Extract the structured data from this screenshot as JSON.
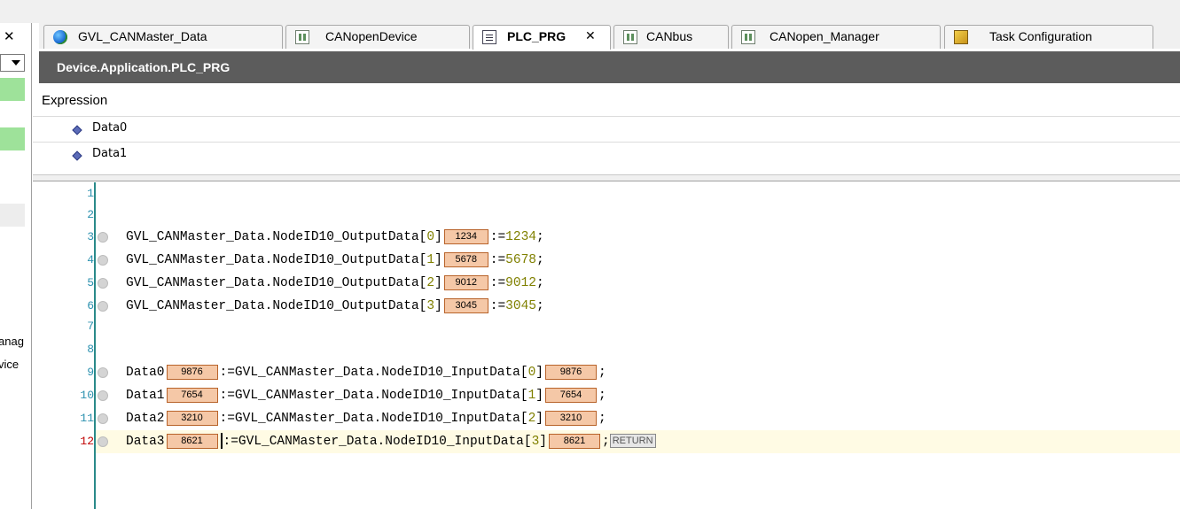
{
  "left_dock": {
    "close_glyph": "✕",
    "items": [
      "anag",
      "vice"
    ]
  },
  "tabs": [
    {
      "label": "GVL_CANMaster_Data",
      "icon": "globe-icon"
    },
    {
      "label": "CANopenDevice",
      "icon": "device-icon"
    },
    {
      "label": "PLC_PRG",
      "icon": "program-icon",
      "active": true,
      "close": "✕"
    },
    {
      "label": "CANbus",
      "icon": "device-icon"
    },
    {
      "label": "CANopen_Manager",
      "icon": "device-icon"
    },
    {
      "label": "Task Configuration",
      "icon": "task-config-icon"
    }
  ],
  "editor": {
    "title": "Device.Application.PLC_PRG"
  },
  "watch": {
    "header": "Expression",
    "items": [
      "Data0",
      "Data1"
    ]
  },
  "code": {
    "line_numbers": [
      "1",
      "2",
      "3",
      "4",
      "5",
      "6",
      "7",
      "8",
      "9",
      "10",
      "11",
      "12"
    ],
    "output_lines": [
      {
        "prefix": "GVL_CANMaster_Data.NodeID10_OutputData",
        "index": "0",
        "monitor": "1234",
        "assign": "1234"
      },
      {
        "prefix": "GVL_CANMaster_Data.NodeID10_OutputData",
        "index": "1",
        "monitor": "5678",
        "assign": "5678"
      },
      {
        "prefix": "GVL_CANMaster_Data.NodeID10_OutputData",
        "index": "2",
        "monitor": "9012",
        "assign": "9012"
      },
      {
        "prefix": "GVL_CANMaster_Data.NodeID10_OutputData",
        "index": "3",
        "monitor": "3045",
        "assign": "3045"
      }
    ],
    "input_lines": [
      {
        "var": "Data0",
        "var_monitor": "9876",
        "source": "GVL_CANMaster_Data.NodeID10_InputData",
        "index": "0",
        "src_monitor": "9876"
      },
      {
        "var": "Data1",
        "var_monitor": "7654",
        "source": "GVL_CANMaster_Data.NodeID10_InputData",
        "index": "1",
        "src_monitor": "7654"
      },
      {
        "var": "Data2",
        "var_monitor": "3210",
        "source": "GVL_CANMaster_Data.NodeID10_InputData",
        "index": "2",
        "src_monitor": "3210"
      },
      {
        "var": "Data3",
        "var_monitor": "8621",
        "source": "GVL_CANMaster_Data.NodeID10_InputData",
        "index": "3",
        "src_monitor": "8621"
      }
    ],
    "assign_op": ":=",
    "semicolon": ";",
    "return_label": "RETURN"
  },
  "colors": {
    "titlebar": "#5c5c5c",
    "monitor_box": "#f5c8a7",
    "line_number": "#2b91af",
    "current_line_number": "#c00000",
    "numeric_literal": "#808000",
    "current_line_bg": "#fffbe4",
    "dock_highlight": "#9ee29a"
  }
}
